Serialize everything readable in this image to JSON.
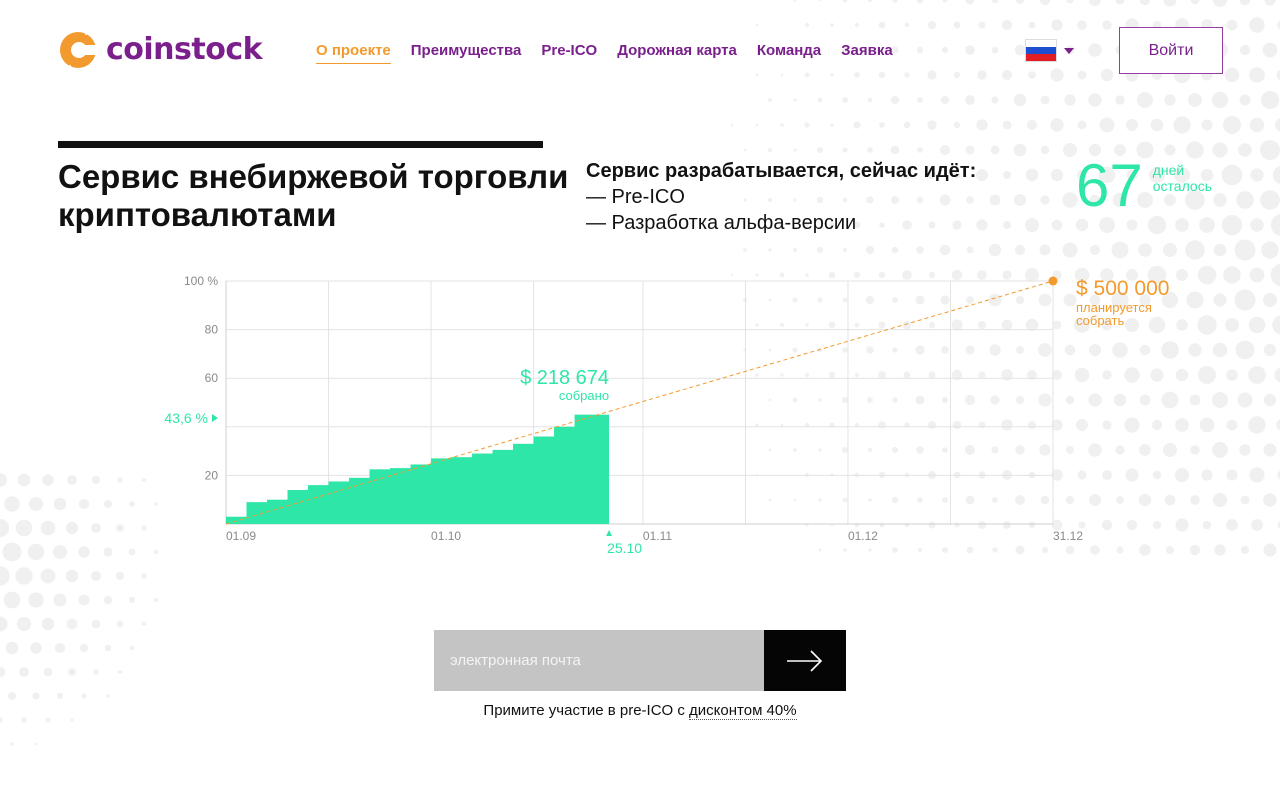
{
  "brand": {
    "name": "coinstock",
    "logo_color": "#f29a2e",
    "text_color": "#7a1f8c"
  },
  "nav": [
    {
      "label": "О проекте",
      "active": true
    },
    {
      "label": "Преимущества",
      "active": false
    },
    {
      "label": "Pre-ICO",
      "active": false
    },
    {
      "label": "Дорожная карта",
      "active": false
    },
    {
      "label": "Команда",
      "active": false
    },
    {
      "label": "Заявка",
      "active": false
    }
  ],
  "language": {
    "flag": "russian-flag-icon",
    "dropdown_icon": "chevron-down-icon"
  },
  "header": {
    "login_label": "Войти"
  },
  "hero": {
    "title": "Сервис внебиржевой торговли криптовалютами",
    "status_heading": "Сервис разрабатывается, сейчас идёт:",
    "status_items": [
      "— Pre-ICO",
      "— Разработка альфа-версии"
    ],
    "days_number": "67",
    "days_label_1": "дней",
    "days_label_2": "осталось"
  },
  "colors": {
    "accent_green": "#2ee6a8",
    "accent_orange": "#f29a2e",
    "purple": "#7a1f8c"
  },
  "chart_data": {
    "type": "area",
    "y_tick_labels": [
      "20",
      "60",
      "80",
      "100 %"
    ],
    "ylim": [
      0,
      100
    ],
    "x_tick_labels": [
      "01.09",
      "01.10",
      "01.11",
      "01.12",
      "31.12"
    ],
    "x_range": [
      "01.09",
      "31.12"
    ],
    "grid": true,
    "series": [
      {
        "name": "собрано",
        "color": "#2ee6a8",
        "x": [
          "01.09",
          "04.09",
          "07.09",
          "10.09",
          "13.09",
          "16.09",
          "19.09",
          "22.09",
          "25.09",
          "28.09",
          "01.10",
          "04.10",
          "07.10",
          "10.10",
          "13.10",
          "16.10",
          "19.10",
          "22.10",
          "25.10"
        ],
        "values": [
          3,
          9,
          10,
          14,
          16,
          17.5,
          19,
          22.5,
          23,
          24.5,
          27,
          27.5,
          29,
          30.5,
          33,
          36,
          40,
          41.5,
          45
        ]
      }
    ],
    "target_line": {
      "from": [
        "01.09",
        0
      ],
      "to": [
        "31.12",
        100
      ],
      "color": "#f29a2e",
      "style": "dashed"
    },
    "current_percent_label": "43,6 %",
    "current_date_label": "25.10",
    "collected_amount": "$ 218 674",
    "collected_label": "собрано",
    "goal_amount": "$ 500 000",
    "goal_label_1": "планируется",
    "goal_label_2": "собрать"
  },
  "signup": {
    "placeholder": "электронная почта",
    "submit_icon": "arrow-right-icon",
    "promo_text": "Примите участие в pre-ICO с ",
    "promo_link": "дисконтом 40%"
  }
}
